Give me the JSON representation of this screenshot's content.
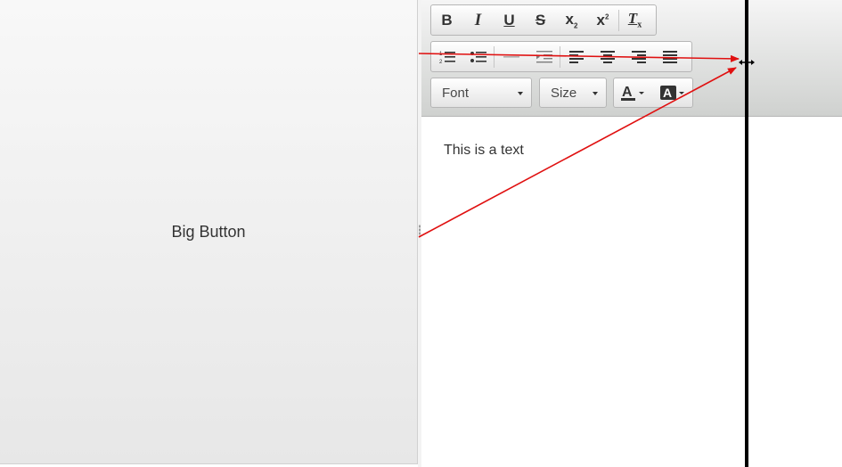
{
  "left_panel": {
    "button_label": "Big Button"
  },
  "toolbar": {
    "row1": [
      {
        "name": "bold",
        "glyph": "B"
      },
      {
        "name": "italic",
        "glyph": "I"
      },
      {
        "name": "underline",
        "glyph": "U"
      },
      {
        "name": "strikethrough",
        "glyph": "S"
      },
      {
        "name": "subscript",
        "glyph": "x"
      },
      {
        "name": "superscript",
        "glyph": "x"
      },
      {
        "name": "remove-format",
        "glyph": "T"
      }
    ],
    "font_label": "Font",
    "size_label": "Size"
  },
  "editor": {
    "content_text": "This is a text"
  },
  "colors": {
    "annotation_arrow": "#ff0000",
    "divider_line": "#000000"
  }
}
